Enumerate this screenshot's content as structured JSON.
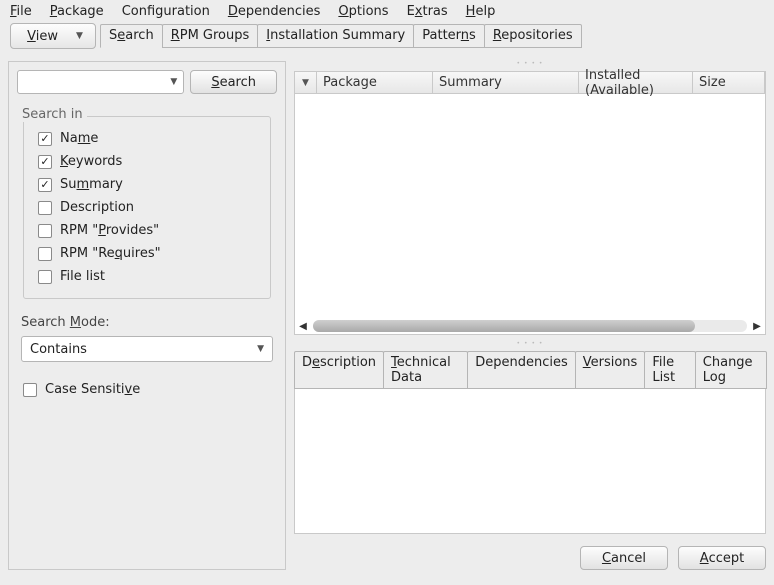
{
  "menu": {
    "file": "File",
    "package": "Package",
    "configuration": "Configuration",
    "dependencies": "Dependencies",
    "options": "Options",
    "extras": "Extras",
    "help": "Help"
  },
  "viewButton": "View",
  "filterTabs": {
    "search": "Search",
    "rpmGroups": "RPM Groups",
    "installationSummary": "Installation Summary",
    "patterns": "Patterns",
    "repositories": "Repositories"
  },
  "searchButton": "Search",
  "searchInLegend": "Search in",
  "searchIn": {
    "name": {
      "label": "Name",
      "checked": true
    },
    "keywords": {
      "label": "Keywords",
      "checked": true
    },
    "summary": {
      "label": "Summary",
      "checked": true
    },
    "description": {
      "label": "Description",
      "checked": false
    },
    "provides": {
      "label": "RPM \"Provides\"",
      "checked": false
    },
    "requires": {
      "label": "RPM \"Requires\"",
      "checked": false
    },
    "filelist": {
      "label": "File list",
      "checked": false
    }
  },
  "searchModeLabel": "Search Mode:",
  "searchModeValue": "Contains",
  "caseSensitive": {
    "label": "Case Sensitive",
    "checked": false
  },
  "listHeaders": {
    "package": "Package",
    "summary": "Summary",
    "installed": "Installed (Available)",
    "size": "Size"
  },
  "detailTabs": {
    "description": "Description",
    "technical": "Technical Data",
    "dependencies": "Dependencies",
    "versions": "Versions",
    "filelist": "File List",
    "changelog": "Change Log"
  },
  "buttons": {
    "cancel": "Cancel",
    "accept": "Accept"
  }
}
